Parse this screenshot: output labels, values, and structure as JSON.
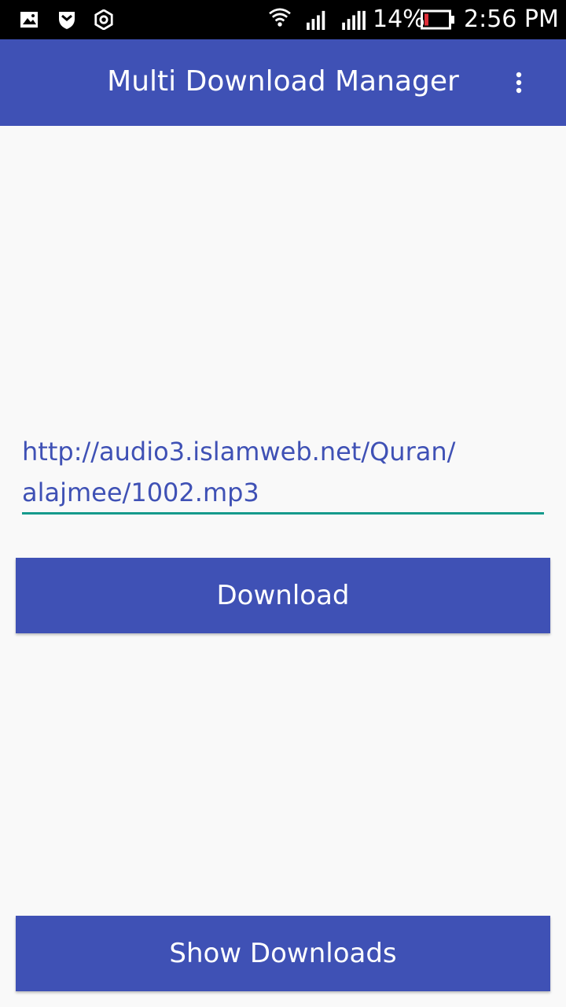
{
  "status_bar": {
    "battery_percent": "14%",
    "time": "2:56 PM",
    "icons": [
      "image-icon",
      "shield-icon",
      "settings-ring-icon",
      "wifi-icon",
      "signal-icon",
      "signal-icon",
      "battery-icon"
    ]
  },
  "app_bar": {
    "title": "Multi Download Manager",
    "overflow_icon": "more-vertical-icon"
  },
  "url_input": {
    "value": "http://audio3.islamweb.net/Quran/alajmee/1002.mp3",
    "line1": "http://audio3.islamweb.net/Quran/",
    "line2": "alajmee/1002.mp3"
  },
  "buttons": {
    "download": "Download",
    "show_downloads": "Show Downloads"
  },
  "colors": {
    "primary": "#3f51b5",
    "accent": "#159a8c",
    "background": "#f9f9f9",
    "status_bar": "#000000"
  }
}
